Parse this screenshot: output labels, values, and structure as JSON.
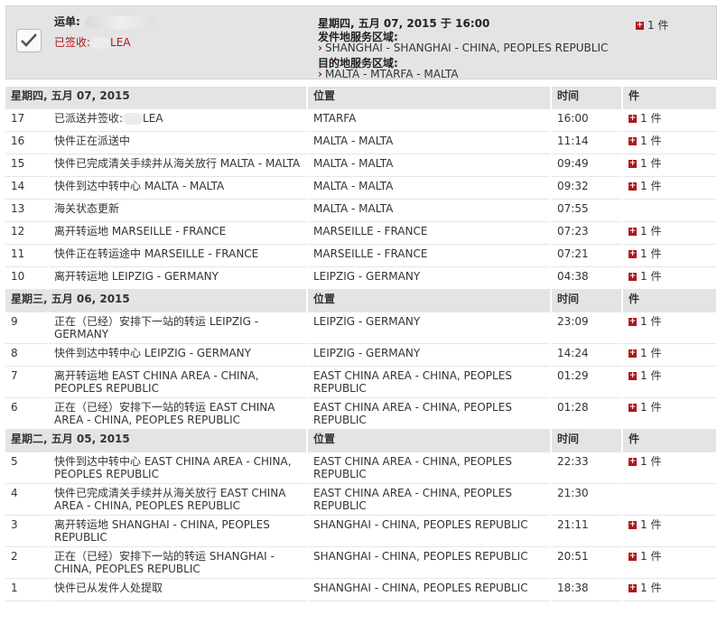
{
  "summary": {
    "waybill_label": "运单:",
    "signed_prefix": "已签收:",
    "signed_name_tail": "LEA",
    "date": "星期四, 五月 07, 2015 于 16:00",
    "origin_label": "发件地服务区域:",
    "origin": "SHANGHAI - SHANGHAI - CHINA, PEOPLES REPUBLIC",
    "dest_label": "目的地服务区域:",
    "dest": "MALTA - MTARFA - MALTA",
    "pieces": "1 件"
  },
  "columns": {
    "location": "位置",
    "time": "时间",
    "pieces": "件"
  },
  "groups": [
    {
      "date": "星期四, 五月 07, 2015",
      "events": [
        {
          "num": "17",
          "desc": "已派送并签收:",
          "desc_tail": "LEA",
          "loc": "MTARFA",
          "time": "16:00",
          "pieces": "1 件"
        },
        {
          "num": "16",
          "desc": "快件正在派送中",
          "loc": "MALTA - MALTA",
          "time": "11:14",
          "pieces": "1 件"
        },
        {
          "num": "15",
          "desc": "快件已完成清关手续并从海关放行 MALTA - MALTA",
          "loc": "MALTA - MALTA",
          "time": "09:49",
          "pieces": "1 件"
        },
        {
          "num": "14",
          "desc": "快件到达中转中心 MALTA - MALTA",
          "loc": "MALTA - MALTA",
          "time": "09:32",
          "pieces": "1 件"
        },
        {
          "num": "13",
          "desc": "海关状态更新",
          "loc": "MALTA - MALTA",
          "time": "07:55",
          "pieces": ""
        },
        {
          "num": "12",
          "desc": "离开转运地 MARSEILLE - FRANCE",
          "loc": "MARSEILLE - FRANCE",
          "time": "07:23",
          "pieces": "1 件"
        },
        {
          "num": "11",
          "desc": "快件正在转运途中 MARSEILLE - FRANCE",
          "loc": "MARSEILLE - FRANCE",
          "time": "07:21",
          "pieces": "1 件"
        },
        {
          "num": "10",
          "desc": "离开转运地 LEIPZIG - GERMANY",
          "loc": "LEIPZIG - GERMANY",
          "time": "04:38",
          "pieces": "1 件"
        }
      ]
    },
    {
      "date": "星期三, 五月 06, 2015",
      "events": [
        {
          "num": "9",
          "desc": "正在（已经）安排下一站的转运 LEIPZIG - GERMANY",
          "loc": "LEIPZIG - GERMANY",
          "time": "23:09",
          "pieces": "1 件"
        },
        {
          "num": "8",
          "desc": "快件到达中转中心 LEIPZIG - GERMANY",
          "loc": "LEIPZIG - GERMANY",
          "time": "14:24",
          "pieces": "1 件"
        },
        {
          "num": "7",
          "desc": "离开转运地 EAST CHINA AREA - CHINA, PEOPLES REPUBLIC",
          "loc": "EAST CHINA AREA - CHINA, PEOPLES REPUBLIC",
          "time": "01:29",
          "pieces": "1 件"
        },
        {
          "num": "6",
          "desc": "正在（已经）安排下一站的转运 EAST CHINA AREA - CHINA, PEOPLES REPUBLIC",
          "loc": "EAST CHINA AREA - CHINA, PEOPLES REPUBLIC",
          "time": "01:28",
          "pieces": "1 件"
        }
      ]
    },
    {
      "date": "星期二, 五月 05, 2015",
      "events": [
        {
          "num": "5",
          "desc": "快件到达中转中心 EAST CHINA AREA - CHINA, PEOPLES REPUBLIC",
          "loc": "EAST CHINA AREA - CHINA, PEOPLES REPUBLIC",
          "time": "22:33",
          "pieces": "1 件"
        },
        {
          "num": "4",
          "desc": "快件已完成清关手续并从海关放行 EAST CHINA AREA - CHINA, PEOPLES REPUBLIC",
          "loc": "EAST CHINA AREA - CHINA, PEOPLES REPUBLIC",
          "time": "21:30",
          "pieces": ""
        },
        {
          "num": "3",
          "desc": "离开转运地 SHANGHAI - CHINA, PEOPLES REPUBLIC",
          "loc": "SHANGHAI - CHINA, PEOPLES REPUBLIC",
          "time": "21:11",
          "pieces": "1 件"
        },
        {
          "num": "2",
          "desc": "正在（已经）安排下一站的转运 SHANGHAI - CHINA, PEOPLES REPUBLIC",
          "loc": "SHANGHAI - CHINA, PEOPLES REPUBLIC",
          "time": "20:51",
          "pieces": "1 件"
        },
        {
          "num": "1",
          "desc": "快件已从发件人处提取",
          "loc": "SHANGHAI - CHINA, PEOPLES REPUBLIC",
          "time": "18:38",
          "pieces": "1 件"
        }
      ]
    }
  ],
  "colors": {
    "accent_red": "#b1161c",
    "header_gray": "#e4e4e4"
  },
  "icons": {
    "expand": "plus-square-icon",
    "check": "check-icon"
  }
}
